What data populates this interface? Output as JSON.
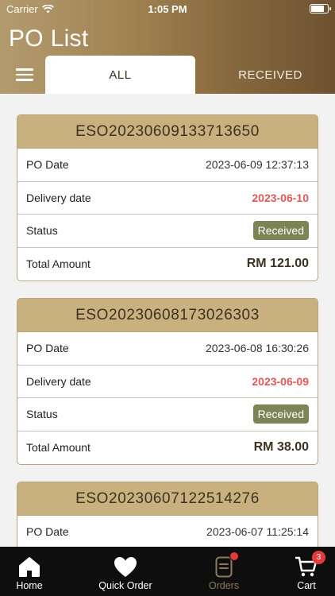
{
  "status_bar": {
    "carrier": "Carrier",
    "time": "1:05 PM"
  },
  "header": {
    "title": "PO List"
  },
  "tabs": [
    {
      "label": "ALL",
      "active": true
    },
    {
      "label": "RECEIVED",
      "active": false
    }
  ],
  "labels": {
    "po_date": "PO Date",
    "delivery_date": "Delivery date",
    "status": "Status",
    "total_amount": "Total Amount"
  },
  "orders": [
    {
      "po_number": "ESO20230609133713650",
      "po_date": "2023-06-09 12:37:13",
      "delivery_date": "2023-06-10",
      "status": "Received",
      "total": "RM 121.00"
    },
    {
      "po_number": "ESO20230608173026303",
      "po_date": "2023-06-08 16:30:26",
      "delivery_date": "2023-06-09",
      "status": "Received",
      "total": "RM 38.00"
    },
    {
      "po_number": "ESO20230607122514276",
      "po_date": "2023-06-07 11:25:14"
    }
  ],
  "tabbar": {
    "items": [
      {
        "label": "Home",
        "icon": "home-icon"
      },
      {
        "label": "Quick Order",
        "icon": "heart-icon"
      },
      {
        "label": "Orders",
        "icon": "orders-icon",
        "active": true
      },
      {
        "label": "Cart",
        "icon": "cart-icon",
        "badge": "3"
      }
    ]
  },
  "colors": {
    "accent_gold": "#c9b17f",
    "status_green": "#7c8455",
    "delivery_red": "#e05858"
  }
}
